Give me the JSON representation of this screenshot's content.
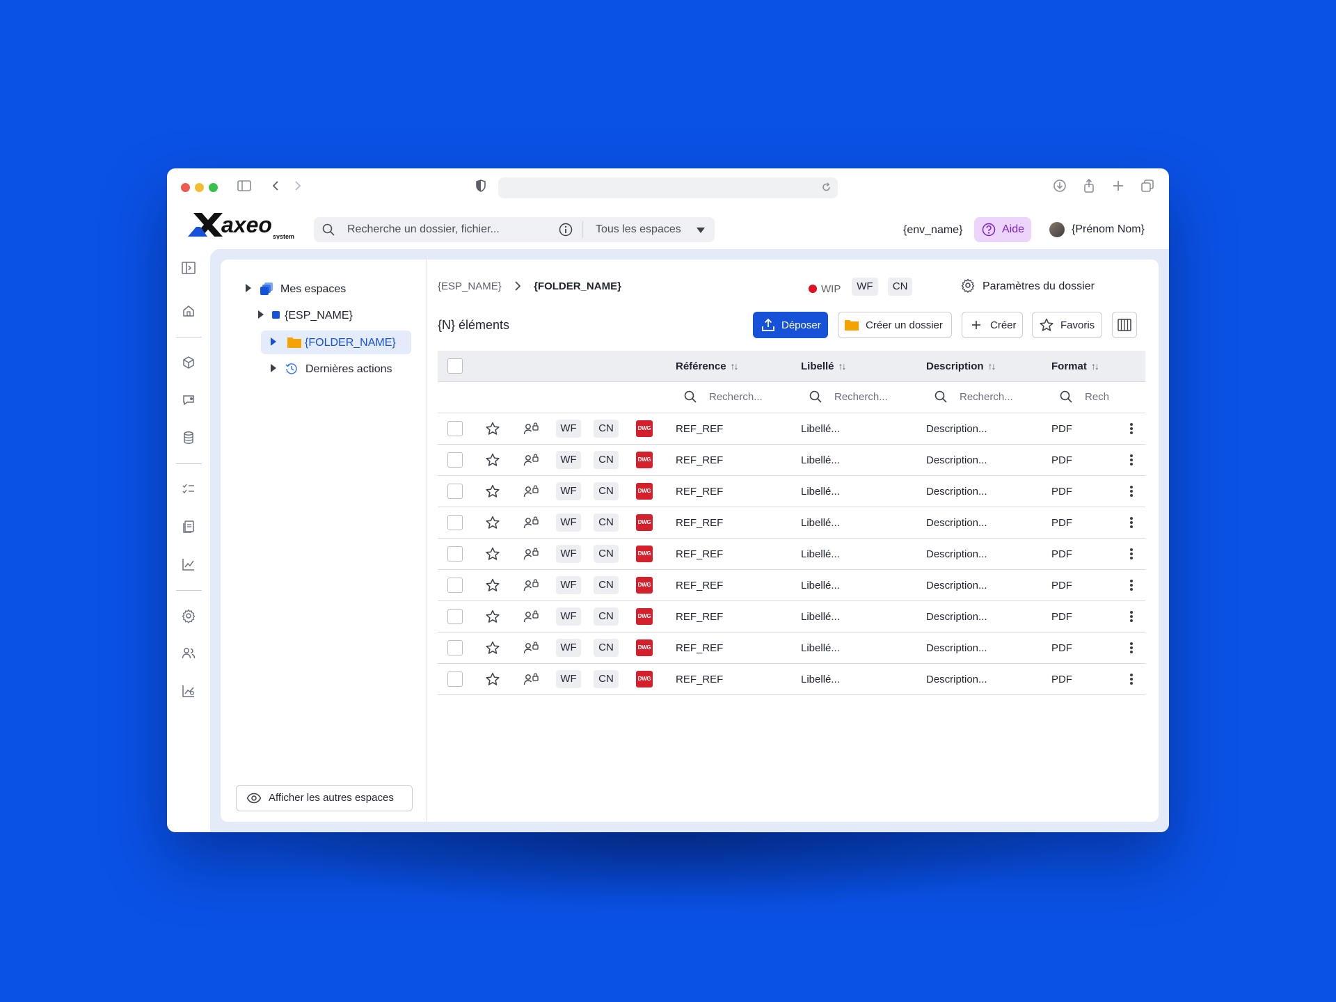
{
  "app": {
    "logo_text": "axeo",
    "logo_sub": "system",
    "search_placeholder": "Recherche un dossier, fichier...",
    "search_scope": "Tous les espaces",
    "env_name": "{env_name}",
    "help_label": "Aide",
    "user_name": "{Prénom Nom}"
  },
  "tree": {
    "root": "Mes espaces",
    "space": "{ESP_NAME}",
    "folder": "{FOLDER_NAME}",
    "recent": "Dernières actions",
    "show_others": "Afficher les autres espaces"
  },
  "breadcrumb": {
    "space": "{ESP_NAME}",
    "folder": "{FOLDER_NAME}"
  },
  "folder_status": {
    "state": "WIP",
    "tag_wf": "WF",
    "tag_cn": "CN",
    "settings_label": "Paramètres du dossier",
    "state_color": "#e01020"
  },
  "toolbar": {
    "count_label": "{N} éléments",
    "upload_label": "Déposer",
    "create_folder_label": "Créer un dossier",
    "create_label": "Créer",
    "favorites_label": "Favoris"
  },
  "table": {
    "columns": [
      {
        "label": "Référence",
        "sort": "↑↓"
      },
      {
        "label": "Libellé",
        "sort": "↑↓"
      },
      {
        "label": "Description",
        "sort": "↑↓"
      },
      {
        "label": "Format",
        "sort": "↑↓"
      }
    ],
    "filter_placeholders": [
      "Recherch...",
      "Recherch...",
      "Recherch...",
      "Rech"
    ],
    "rows": [
      {
        "wf": "WF",
        "cn": "CN",
        "file_type": "DWG",
        "reference": "REF_REF",
        "label": "Libellé...",
        "description": "Description...",
        "format": "PDF"
      },
      {
        "wf": "WF",
        "cn": "CN",
        "file_type": "DWG",
        "reference": "REF_REF",
        "label": "Libellé...",
        "description": "Description...",
        "format": "PDF"
      },
      {
        "wf": "WF",
        "cn": "CN",
        "file_type": "DWG",
        "reference": "REF_REF",
        "label": "Libellé...",
        "description": "Description...",
        "format": "PDF"
      },
      {
        "wf": "WF",
        "cn": "CN",
        "file_type": "DWG",
        "reference": "REF_REF",
        "label": "Libellé...",
        "description": "Description...",
        "format": "PDF"
      },
      {
        "wf": "WF",
        "cn": "CN",
        "file_type": "DWG",
        "reference": "REF_REF",
        "label": "Libellé...",
        "description": "Description...",
        "format": "PDF"
      },
      {
        "wf": "WF",
        "cn": "CN",
        "file_type": "DWG",
        "reference": "REF_REF",
        "label": "Libellé...",
        "description": "Description...",
        "format": "PDF"
      },
      {
        "wf": "WF",
        "cn": "CN",
        "file_type": "DWG",
        "reference": "REF_REF",
        "label": "Libellé...",
        "description": "Description...",
        "format": "PDF"
      },
      {
        "wf": "WF",
        "cn": "CN",
        "file_type": "DWG",
        "reference": "REF_REF",
        "label": "Libellé...",
        "description": "Description...",
        "format": "PDF"
      },
      {
        "wf": "WF",
        "cn": "CN",
        "file_type": "DWG",
        "reference": "REF_REF",
        "label": "Libellé...",
        "description": "Description...",
        "format": "PDF"
      }
    ]
  },
  "colors": {
    "background": "#0a52e6",
    "primary": "#1552d8",
    "help_bg": "#ecd4fb",
    "help_fg": "#7b22c9",
    "file_badge": "#d4202b",
    "folder": "#f5a300"
  }
}
